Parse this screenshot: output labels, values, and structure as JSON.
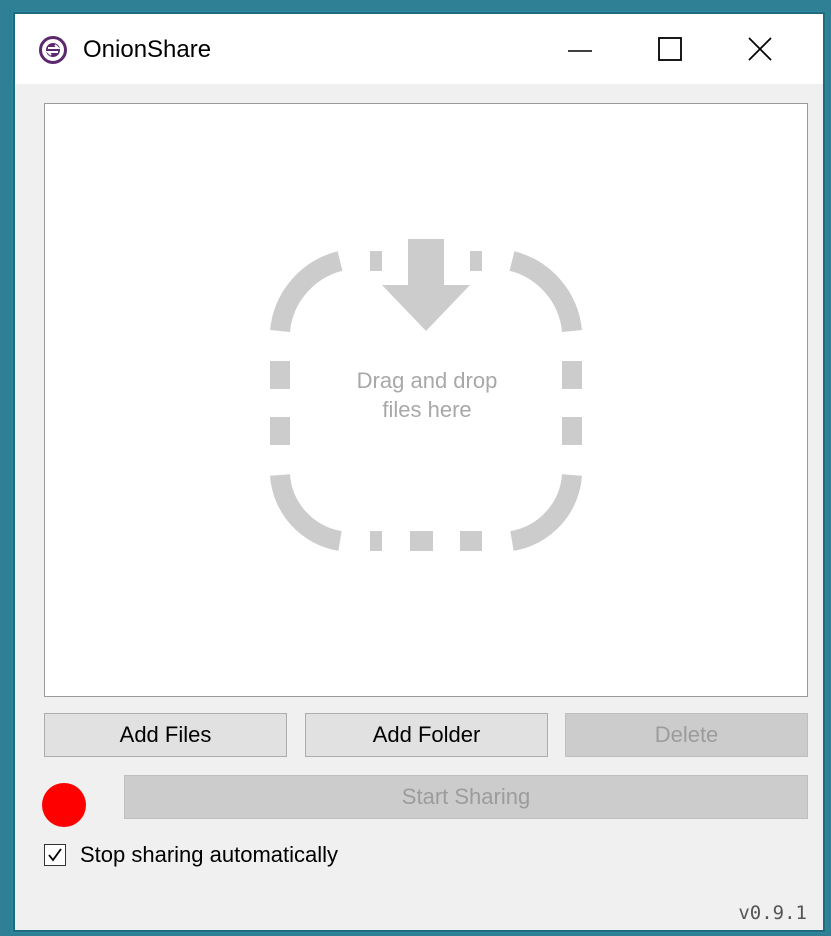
{
  "window": {
    "title": "OnionShare"
  },
  "drop_zone": {
    "line1": "Drag and drop",
    "line2": "files here"
  },
  "buttons": {
    "add_files": "Add Files",
    "add_folder": "Add Folder",
    "delete": "Delete",
    "start_sharing": "Start Sharing"
  },
  "status": {
    "indicator_color": "#ff0000"
  },
  "options": {
    "stop_sharing_automatically": {
      "label": "Stop sharing automatically",
      "checked": true
    }
  },
  "version": "v0.9.1",
  "colors": {
    "brand": "#5b2a6e",
    "disabled_text": "#9c9c9c",
    "drop_graphic": "#cccccc"
  }
}
